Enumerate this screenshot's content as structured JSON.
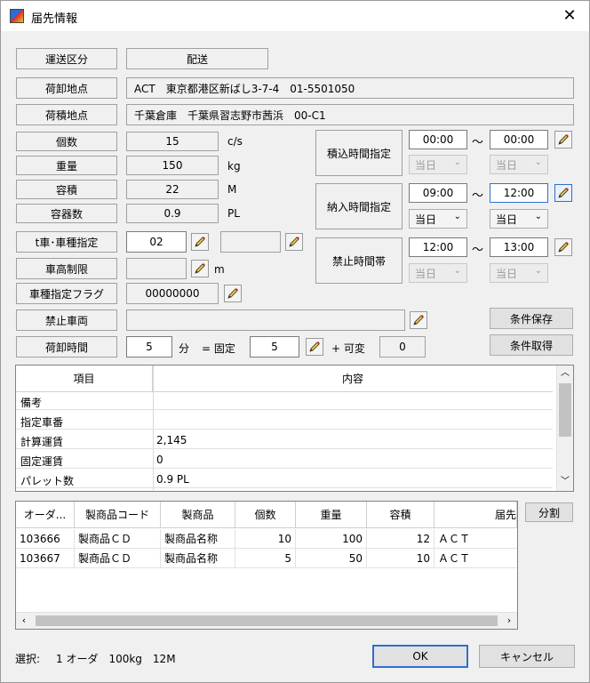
{
  "window": {
    "title": "届先情報",
    "close_glyph": "✕"
  },
  "fields": {
    "transport_type": {
      "label": "運送区分",
      "value": "配送"
    },
    "unload_point": {
      "label": "荷卸地点",
      "value": "ACT　東京都港区新ばし3-7-4　01-5501050"
    },
    "load_point": {
      "label": "荷積地点",
      "value": "千葉倉庫　千葉県習志野市茜浜　00-C1"
    },
    "count": {
      "label": "個数",
      "value": "15",
      "unit": "c/s"
    },
    "weight": {
      "label": "重量",
      "value": "150",
      "unit": "kg"
    },
    "volume": {
      "label": "容積",
      "value": "22",
      "unit": "M"
    },
    "containers": {
      "label": "容器数",
      "value": "0.9",
      "unit": "PL"
    },
    "vehicle_type": {
      "label": "t車･車種指定",
      "value": "02",
      "value2": ""
    },
    "height_limit": {
      "label": "車高制限",
      "value": "",
      "unit": "m"
    },
    "vehicle_flag": {
      "label": "車種指定フラグ",
      "value": "00000000"
    },
    "banned_vehicle": {
      "label": "禁止車両",
      "value": ""
    },
    "unload_time": {
      "label": "荷卸時間",
      "total": "5",
      "unit": "分",
      "fixed_label": "= 固定",
      "fixed": "5",
      "var_label": "+ 可変",
      "variable": "0"
    }
  },
  "times": {
    "loading": {
      "label": "積込時間指定",
      "from": "00:00",
      "to": "00:00",
      "from_day": "当日",
      "to_day": "当日"
    },
    "delivery": {
      "label": "納入時間指定",
      "from": "09:00",
      "to": "12:00",
      "from_day": "当日",
      "to_day": "当日"
    },
    "prohibited": {
      "label": "禁止時間帯",
      "from": "12:00",
      "to": "13:00",
      "from_day": "当日",
      "to_day": "当日"
    },
    "tilde": "～"
  },
  "buttons": {
    "save_conditions": "条件保存",
    "get_conditions": "条件取得",
    "split": "分割",
    "ok": "OK",
    "cancel": "キャンセル"
  },
  "info_grid": {
    "headers": [
      "項目",
      "内容"
    ],
    "rows": [
      {
        "item": "備考",
        "content": ""
      },
      {
        "item": "指定車番",
        "content": ""
      },
      {
        "item": "計算運賃",
        "content": "2,145"
      },
      {
        "item": "固定運賃",
        "content": "0"
      },
      {
        "item": "パレット数",
        "content": "0.9 PL"
      }
    ]
  },
  "order_grid": {
    "headers": [
      "オーダ...",
      "製商品コード",
      "製商品",
      "個数",
      "重量",
      "容積",
      "届先"
    ],
    "rows": [
      [
        "103666",
        "製商品ＣＤ",
        "製商品名称",
        "10",
        "100",
        "12",
        "ＡＣＴ"
      ],
      [
        "103667",
        "製商品ＣＤ",
        "製商品名称",
        "5",
        "50",
        "10",
        "ＡＣＴ"
      ]
    ]
  },
  "status": {
    "label": "選択:",
    "text": "1 オーダ　100kg　12M"
  }
}
